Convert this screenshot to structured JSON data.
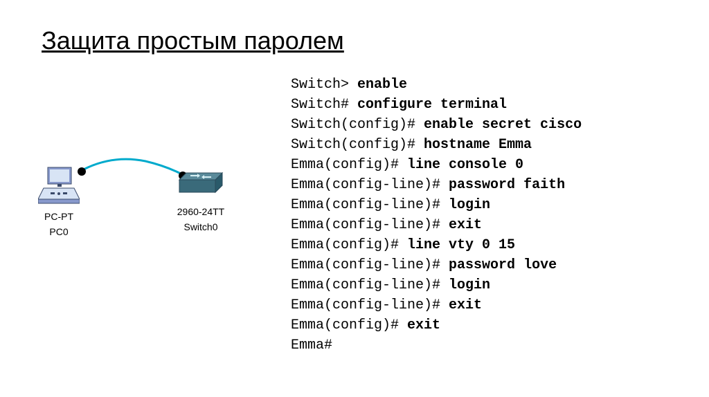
{
  "title": "Защита простым паролем",
  "topology": {
    "pc": {
      "line1": "PC-PT",
      "line2": "PC0"
    },
    "switch": {
      "line1": "2960-24TT",
      "line2": "Switch0"
    }
  },
  "terminal": [
    {
      "prompt": "Switch> ",
      "command": "enable"
    },
    {
      "prompt": "Switch# ",
      "command": "configure terminal"
    },
    {
      "prompt": "Switch(config)# ",
      "command": "enable secret cisco"
    },
    {
      "prompt": "Switch(config)# ",
      "command": "hostname Emma"
    },
    {
      "prompt": "Emma(config)# ",
      "command": "line console 0"
    },
    {
      "prompt": "Emma(config-line)# ",
      "command": "password faith"
    },
    {
      "prompt": "Emma(config-line)# ",
      "command": "login"
    },
    {
      "prompt": "Emma(config-line)# ",
      "command": "exit"
    },
    {
      "prompt": "Emma(config)# ",
      "command": "line vty 0 15"
    },
    {
      "prompt": "Emma(config-line)# ",
      "command": "password love"
    },
    {
      "prompt": "Emma(config-line)# ",
      "command": "login"
    },
    {
      "prompt": "Emma(config-line)# ",
      "command": "exit"
    },
    {
      "prompt": "Emma(config)# ",
      "command": "exit"
    },
    {
      "prompt": "Emma#",
      "command": ""
    }
  ]
}
